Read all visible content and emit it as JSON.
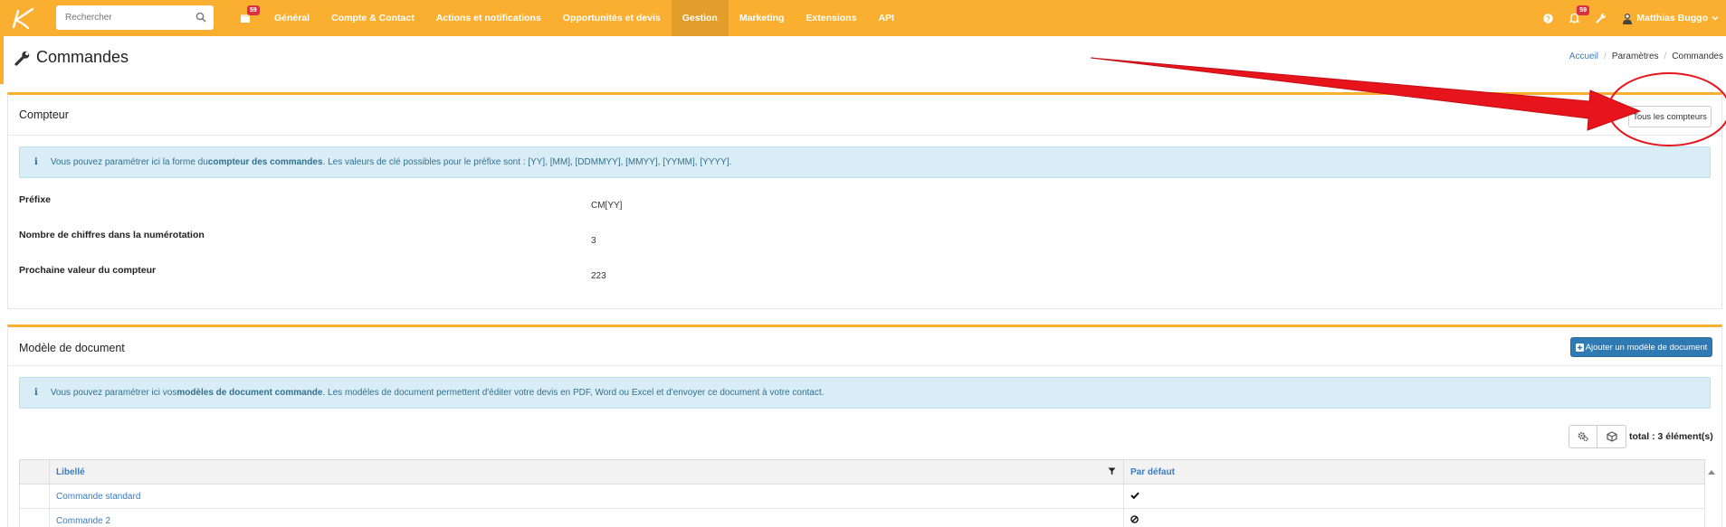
{
  "topbar": {
    "search_placeholder": "Rechercher",
    "calendar_badge": "59",
    "nav": [
      "Général",
      "Compte & Contact",
      "Actions et notifications",
      "Opportunités et devis",
      "Gestion",
      "Marketing",
      "Extensions",
      "API"
    ],
    "active_nav": "Gestion",
    "notif_badge": "59",
    "user_name": "Matthias Buggo"
  },
  "page": {
    "title": "Commandes",
    "breadcrumb": [
      "Accueil",
      "Paramètres",
      "Commandes"
    ]
  },
  "compteur": {
    "title": "Compteur",
    "all_counters_button": "Tous les compteurs",
    "alert_prefix": "Vous pouvez paramétrer ici la forme du ",
    "alert_bold": "compteur des commandes",
    "alert_suffix": ". Les valeurs de clé possibles pour le préfixe sont : [YY], [MM], [DDMMYY], [MMYY], [YYMM], [YYYY].",
    "fields": [
      {
        "label": "Préfixe",
        "value": "CM[YY]"
      },
      {
        "label": "Nombre de chiffres dans la numérotation",
        "value": "3"
      },
      {
        "label": "Prochaine valeur du compteur",
        "value": "223"
      }
    ]
  },
  "modele": {
    "title": "Modèle de document",
    "add_button": "Ajouter un modèle de document",
    "alert_prefix": "Vous pouvez paramétrer ici vos ",
    "alert_bold": "modèles de document commande",
    "alert_suffix": ". Les modèles de document permettent d'éditer votre devis en PDF, Word ou Excel et d'envoyer ce document à votre contact.",
    "total": "total : 3 élément(s)",
    "columns": [
      "Libellé",
      "Par défaut"
    ],
    "rows": [
      {
        "label": "Commande standard",
        "default": true
      },
      {
        "label": "Commande 2",
        "default": false
      }
    ]
  },
  "colors": {
    "accent": "#fbaf31",
    "active_nav": "#e29e2b",
    "primary_button": "#2f7ab3",
    "alert_bg": "#d9edf7",
    "annotation": "#e8141c"
  }
}
